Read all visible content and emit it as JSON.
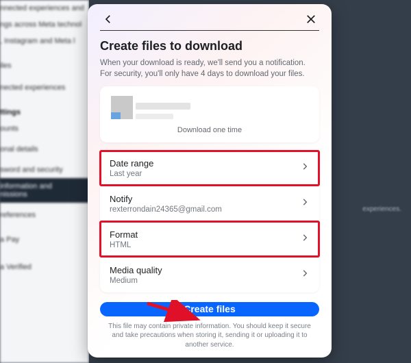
{
  "bg": {
    "intro1": "nnected experiences and",
    "intro2": "ngs across Meta technol",
    "intro3": ", Instagram and Meta l",
    "item_files": "iles",
    "item_connected": "nected experiences",
    "heading_settings": "ttings",
    "item_accounts": "ounts",
    "item_personal": "onal details",
    "item_password": "sword and security",
    "item_active1": "information and",
    "item_active2": "nissions",
    "item_prefs": "references",
    "item_pay": "a Pay",
    "item_verified": "a Verified",
    "right_hint": "experiences."
  },
  "modal": {
    "title": "Create files to download",
    "desc": "When your download is ready, we'll send you a notification. For security, you'll only have 4 days to download your files.",
    "one_time": "Download one time",
    "rows": {
      "date_range": {
        "label": "Date range",
        "value": "Last year"
      },
      "notify": {
        "label": "Notify",
        "value": "rexterrondain24365@gmail.com"
      },
      "format": {
        "label": "Format",
        "value": "HTML"
      },
      "media": {
        "label": "Media quality",
        "value": "Medium"
      }
    },
    "button": "Create files",
    "disclaimer": "This file may contain private information. You should keep it secure and take precautions when storing it, sending it or uploading it to another service."
  }
}
